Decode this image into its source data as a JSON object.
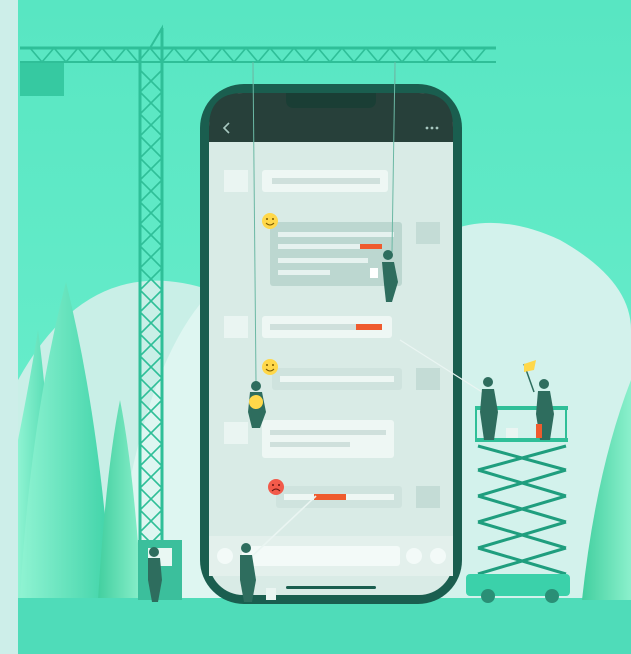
{
  "illustration": {
    "colors": {
      "frame": "#cdeee9",
      "sky": "#5ce8c4",
      "hill": "#d3f2ec",
      "ground": "#4fdcb9",
      "crane": "#2fbf98",
      "phone_body": "#1a5e4f",
      "phone_header": "#27403a",
      "phone_screen": "#d9ebe6",
      "bubble": "#eef7f4",
      "bubble_line": "#cfe0dc",
      "accent": "#ef5b2e",
      "worker": "#2e6d5e",
      "emoji": "#ffd84a"
    },
    "icons": {
      "back": "chevron-left-icon",
      "menu": "more-dots-icon",
      "smile": "smile-emoji-icon",
      "sad": "sad-emoji-icon",
      "flag": "flag-icon"
    },
    "progress": {
      "bubble_1": 0.22,
      "bubble_3": 0.22,
      "bubble_7": 0.5
    }
  }
}
